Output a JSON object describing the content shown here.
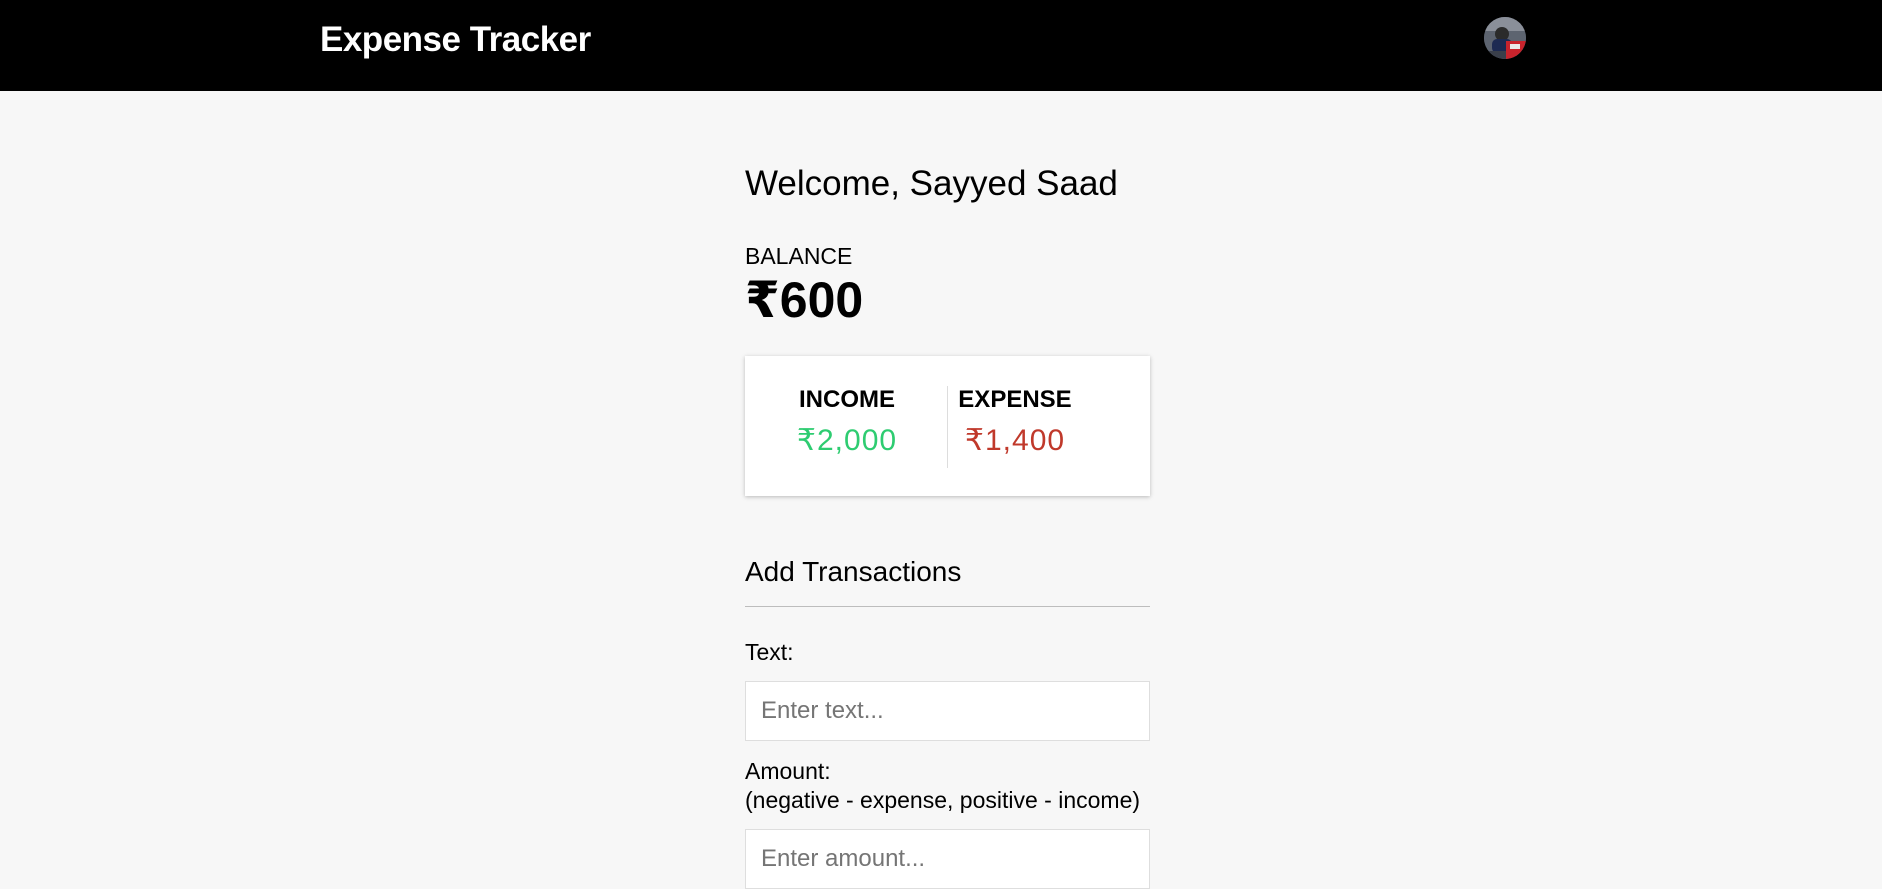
{
  "header": {
    "title": "Expense Tracker",
    "avatar_icon": "user-avatar-photo"
  },
  "welcome": {
    "greeting": "Welcome, Sayyed Saad"
  },
  "balance": {
    "label": "BALANCE",
    "value": "₹600"
  },
  "summary": {
    "income_label": "INCOME",
    "income_value": "₹2,000",
    "expense_label": "EXPENSE",
    "expense_value": "₹1,400",
    "income_color": "#2ecc71",
    "expense_color": "#c0392b"
  },
  "add_transaction": {
    "title": "Add Transactions",
    "text_label": "Text:",
    "text_placeholder": "Enter text...",
    "amount_label": "Amount:",
    "amount_hint": "(negative - expense, positive - income)",
    "amount_placeholder": "Enter amount..."
  }
}
